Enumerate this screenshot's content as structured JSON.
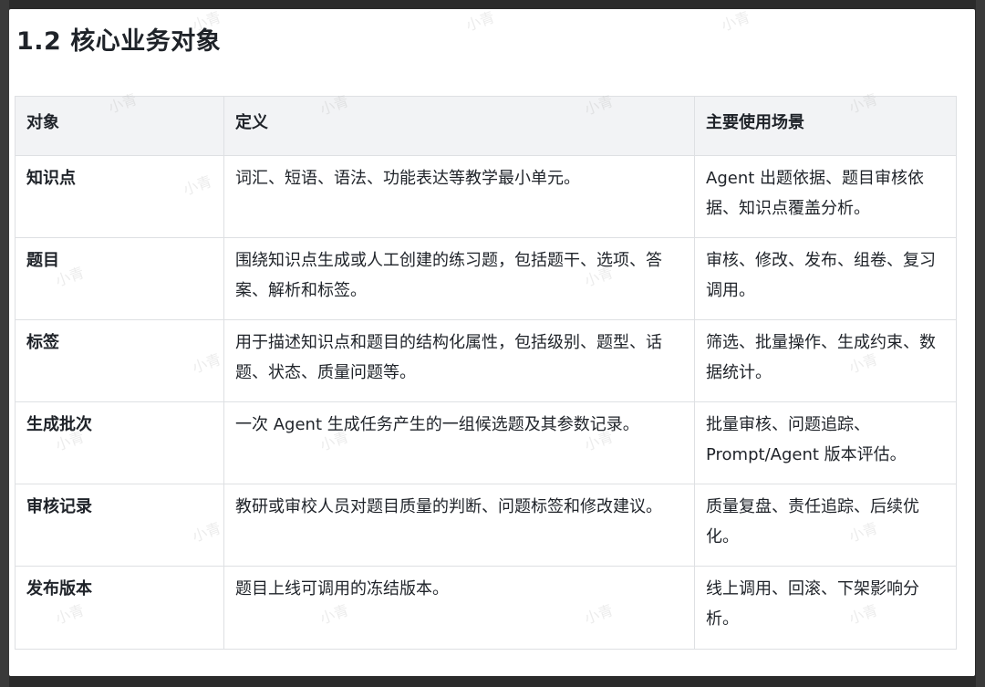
{
  "section": {
    "title": "1.2 核心业务对象"
  },
  "table": {
    "headers": [
      "对象",
      "定义",
      "主要使用场景"
    ],
    "rows": [
      {
        "object": "知识点",
        "definition": "词汇、短语、语法、功能表达等教学最小单元。",
        "usage": "Agent 出题依据、题目审核依据、知识点覆盖分析。"
      },
      {
        "object": "题目",
        "definition": "围绕知识点生成或人工创建的练习题，包括题干、选项、答案、解析和标签。",
        "usage": "审核、修改、发布、组卷、复习调用。"
      },
      {
        "object": "标签",
        "definition": "用于描述知识点和题目的结构化属性，包括级别、题型、话题、状态、质量问题等。",
        "usage": "筛选、批量操作、生成约束、数据统计。"
      },
      {
        "object": "生成批次",
        "definition": "一次 Agent 生成任务产生的一组候选题及其参数记录。",
        "usage": "批量审核、问题追踪、Prompt/Agent 版本评估。"
      },
      {
        "object": "审核记录",
        "definition": "教研或审校人员对题目质量的判断、问题标签和修改建议。",
        "usage": "质量复盘、责任追踪、后续优化。"
      },
      {
        "object": "发布版本",
        "definition": "题目上线可调用的冻结版本。",
        "usage": "线上调用、回滚、下架影响分析。"
      }
    ]
  },
  "watermark": {
    "text": "小青"
  }
}
